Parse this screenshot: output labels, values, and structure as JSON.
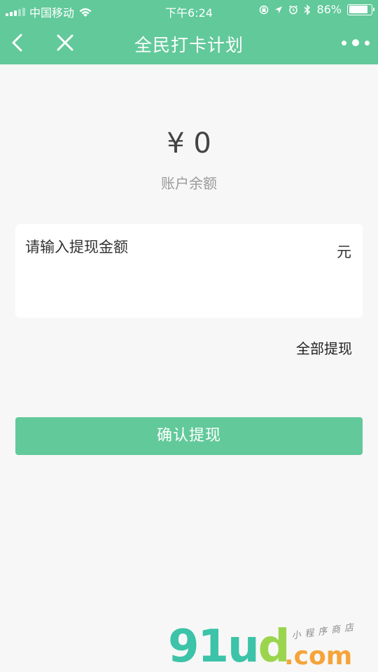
{
  "status_bar": {
    "carrier": "中国移动",
    "time": "下午6:24",
    "battery_percent": "86%",
    "battery_level": 0.86,
    "icons": [
      "signal-icon",
      "wifi-icon",
      "orientation-lock-icon",
      "location-icon",
      "alarm-icon",
      "bluetooth-icon",
      "battery-icon"
    ]
  },
  "nav": {
    "title": "全民打卡计划",
    "back_icon": "chevron-left-icon",
    "close_icon": "close-icon",
    "more_icon": "more-dots-icon"
  },
  "balance": {
    "amount": "¥ 0",
    "label": "账户余额"
  },
  "withdraw_form": {
    "placeholder": "请输入提现金额",
    "unit": "元",
    "withdraw_all_label": "全部提现",
    "confirm_label": "确认提现"
  },
  "watermark": {
    "logo_main": "91u",
    "logo_d": "d",
    "logo_domain": ".com",
    "logo_sub": "小程序商店"
  },
  "colors": {
    "brand_green": "#62c99a",
    "background": "#f7f7f7"
  }
}
